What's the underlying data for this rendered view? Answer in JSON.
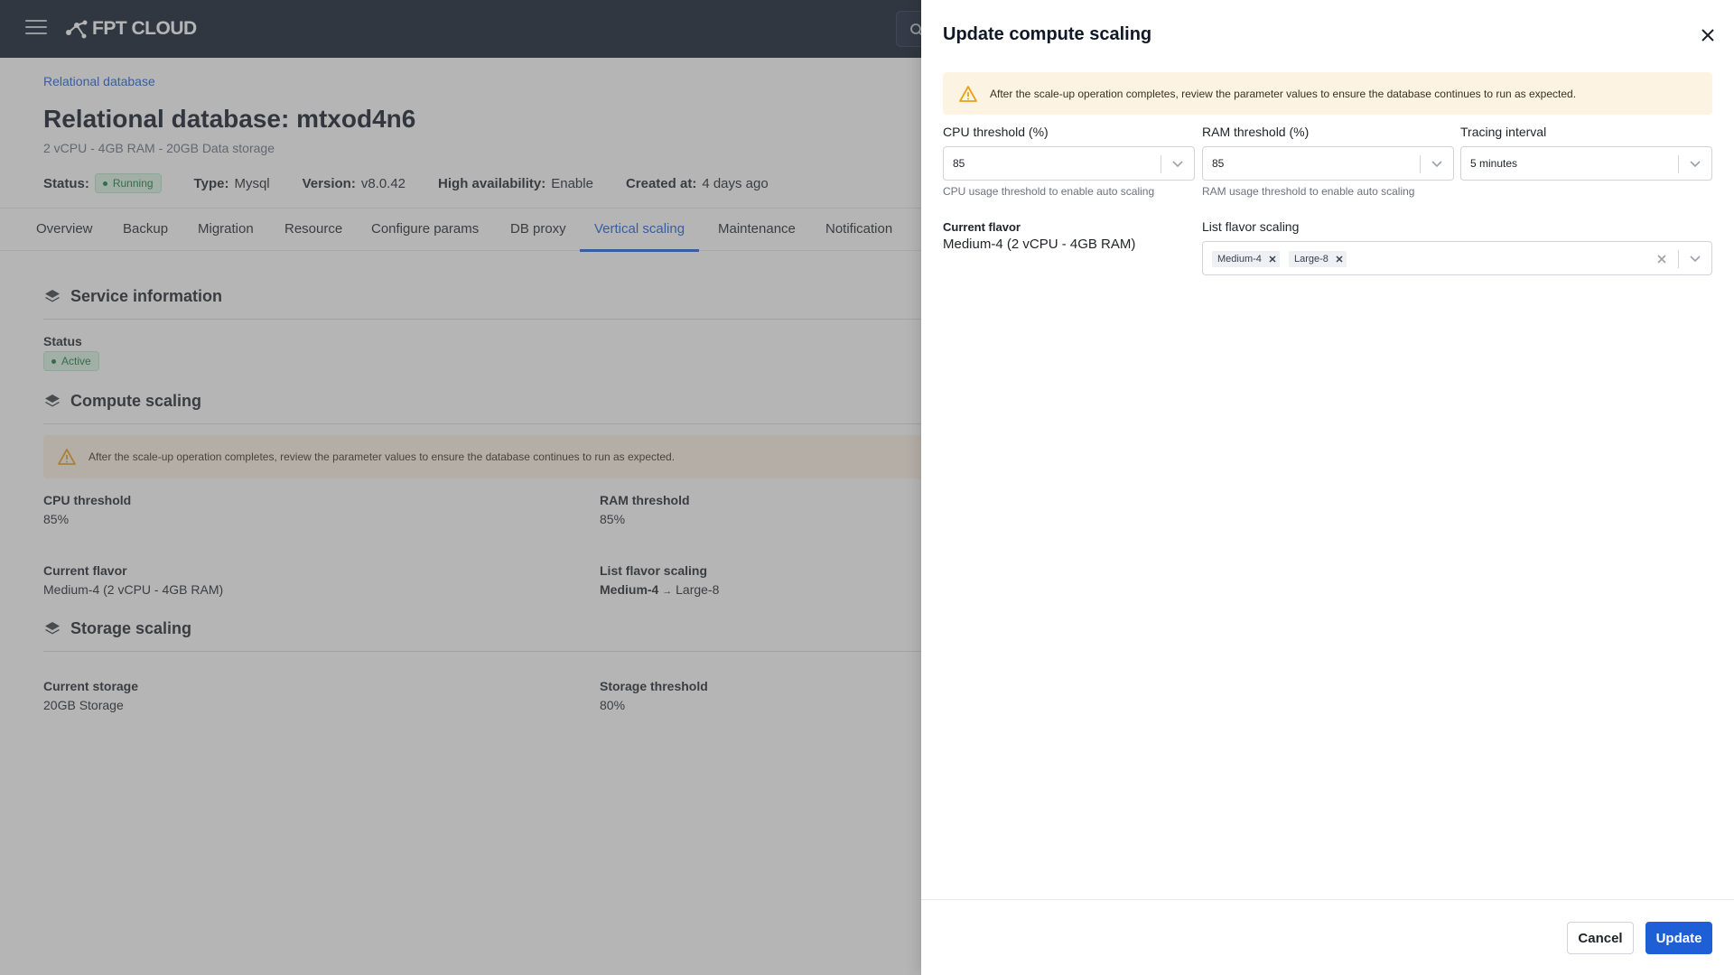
{
  "topbar": {
    "logo_text": "FPT CLOUD"
  },
  "page": {
    "breadcrumb": "Relational database",
    "title": "Relational database: mtxod4n6",
    "subtitle": "2 vCPU - 4GB RAM - 20GB Data storage",
    "meta": {
      "status_key": "Status:",
      "status_value": "Running",
      "type_key": "Type:",
      "type_value": "Mysql",
      "version_key": "Version:",
      "version_value": "v8.0.42",
      "ha_key": "High availability:",
      "ha_value": "Enable",
      "created_key": "Created at:",
      "created_value": "4 days ago"
    },
    "tabs": [
      "Overview",
      "Backup",
      "Migration",
      "Resource",
      "Configure params",
      "DB proxy",
      "Vertical scaling",
      "Maintenance",
      "Notification"
    ],
    "service_info": {
      "heading": "Service information",
      "status_label": "Status",
      "status_value": "Active"
    },
    "compute": {
      "heading": "Compute scaling",
      "warning": "After the scale-up operation completes, review the parameter values to ensure the database continues to run as expected.",
      "cpu_label": "CPU threshold",
      "cpu_value": "85%",
      "ram_label": "RAM threshold",
      "ram_value": "85%",
      "flavor_label": "Current flavor",
      "flavor_value": "Medium-4 (2 vCPU - 4GB RAM)",
      "list_label": "List flavor scaling",
      "list_from": "Medium-4",
      "list_arrow": "→",
      "list_to": "Large-8"
    },
    "storage": {
      "heading": "Storage scaling",
      "current_label": "Current storage",
      "current_value": "20GB Storage",
      "threshold_label": "Storage threshold",
      "threshold_value": "80%"
    }
  },
  "drawer": {
    "title": "Update compute scaling",
    "alert": "After the scale-up operation completes, review the parameter values to ensure the database continues to run as expected.",
    "cpu": {
      "label": "CPU threshold (%)",
      "value": "85",
      "hint": "CPU usage threshold to enable auto scaling"
    },
    "ram": {
      "label": "RAM threshold (%)",
      "value": "85",
      "hint": "RAM usage threshold to enable auto scaling"
    },
    "interval": {
      "label": "Tracing interval",
      "value": "5 minutes"
    },
    "current_flavor": {
      "label": "Current flavor",
      "value": "Medium-4 (2 vCPU - 4GB RAM)"
    },
    "flavor_list": {
      "label": "List flavor scaling",
      "tags": [
        "Medium-4",
        "Large-8"
      ]
    },
    "cancel_label": "Cancel",
    "update_label": "Update"
  },
  "colors": {
    "accent": "#1f5fd6",
    "topbar": "#0f1a2b",
    "warning_bg": "#fdf3e3",
    "warning_icon": "#e8a317"
  }
}
